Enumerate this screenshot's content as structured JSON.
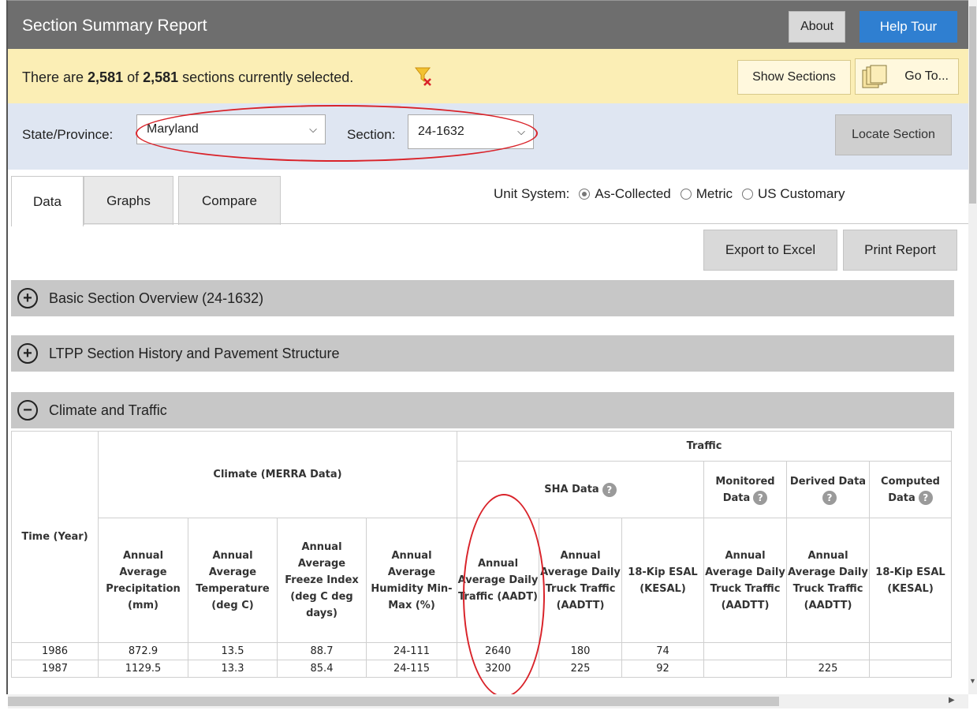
{
  "header": {
    "title": "Section Summary Report",
    "about_label": "About",
    "help_label": "Help Tour"
  },
  "banner": {
    "prefix": "There are ",
    "selected": "2,581",
    "of": " of ",
    "total": "2,581",
    "suffix": " sections currently selected.",
    "show_sections_label": "Show Sections",
    "goto_label": "Go To..."
  },
  "filters": {
    "state_label": "State/Province:",
    "state_value": "Maryland",
    "section_label": "Section:",
    "section_value": "24-1632",
    "locate_label": "Locate Section"
  },
  "tabs": [
    "Data",
    "Graphs",
    "Compare"
  ],
  "units": {
    "label": "Unit System:",
    "options": [
      "As-Collected",
      "Metric",
      "US Customary"
    ],
    "selected": "As-Collected"
  },
  "actions": {
    "export": "Export to Excel",
    "print": "Print Report"
  },
  "sections": [
    {
      "label": "Basic Section Overview (24-1632)",
      "state": "collapsed"
    },
    {
      "label": "LTPP Section History and Pavement Structure",
      "state": "collapsed"
    },
    {
      "label": "Climate and Traffic",
      "state": "expanded"
    }
  ],
  "table": {
    "time_header": "Time (Year)",
    "climate_group": "Climate (MERRA Data)",
    "traffic_group": "Traffic",
    "sha_group": "SHA Data",
    "monitored_group": "Monitored Data",
    "derived_group": "Derived Data",
    "computed_group": "Computed Data",
    "columns": {
      "precip": "Annual Average Precipitation (mm)",
      "temp": "Annual Average Temperature (deg C)",
      "freeze": "Annual Average Freeze Index (deg C deg days)",
      "humidity": "Annual Average Humidity Min-Max (%)",
      "aadt": "Annual Average Daily Traffic (AADT)",
      "sha_aadtt": "Annual Average Daily Truck Traffic (AADTT)",
      "sha_esal": "18-Kip ESAL (KESAL)",
      "mon_aadtt": "Annual Average Daily Truck Traffic (AADTT)",
      "der_aadtt": "Annual Average Daily Truck Traffic (AADTT)",
      "comp_esal": "18-Kip ESAL (KESAL)"
    },
    "rows": [
      {
        "year": "1986",
        "precip": "872.9",
        "temp": "13.5",
        "freeze": "88.7",
        "humidity": "24-111",
        "aadt": "2640",
        "sha_aadtt": "180",
        "sha_esal": "74",
        "mon_aadtt": "",
        "der_aadtt": "",
        "comp_esal": ""
      },
      {
        "year": "1987",
        "precip": "1129.5",
        "temp": "13.3",
        "freeze": "85.4",
        "humidity": "24-115",
        "aadt": "3200",
        "sha_aadtt": "225",
        "sha_esal": "92",
        "mon_aadtt": "",
        "der_aadtt": "225",
        "comp_esal": ""
      }
    ]
  },
  "colors": {
    "titlebar": "#6e6e6e",
    "help": "#2f7fd1",
    "banner": "#fbeeb5",
    "filterbar": "#dfe6f2",
    "annotation": "#d9232a"
  }
}
